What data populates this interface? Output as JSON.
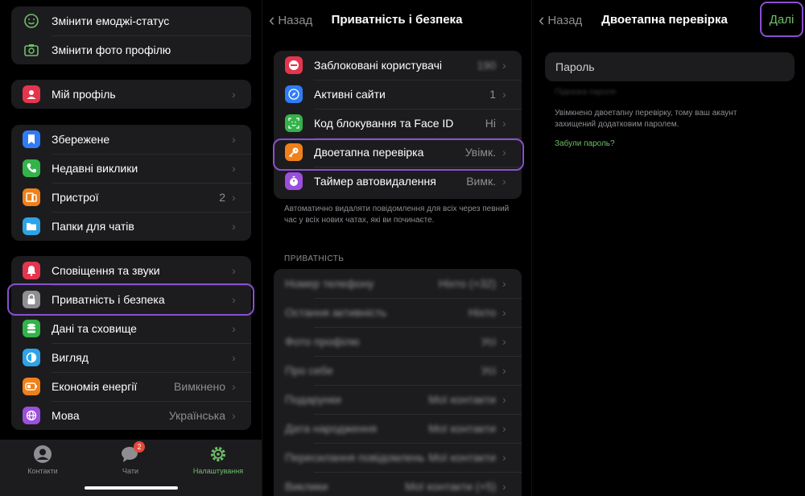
{
  "panel1": {
    "top_group": {
      "emoji_status": "Змінити емоджі-статус",
      "profile_photo": "Змінити фото профілю"
    },
    "profile": {
      "label": "Мій профіль"
    },
    "group2": [
      {
        "label": "Збережене",
        "value": ""
      },
      {
        "label": "Недавні виклики",
        "value": ""
      },
      {
        "label": "Пристрої",
        "value": "2"
      },
      {
        "label": "Папки для чатів",
        "value": ""
      }
    ],
    "group3": [
      {
        "label": "Сповіщення та звуки",
        "value": ""
      },
      {
        "label": "Приватність і безпека",
        "value": ""
      },
      {
        "label": "Дані та сховище",
        "value": ""
      },
      {
        "label": "Вигляд",
        "value": ""
      },
      {
        "label": "Економія енергії",
        "value": "Вимкнено"
      },
      {
        "label": "Мова",
        "value": "Українська"
      }
    ],
    "tabs": {
      "contacts": "Контакти",
      "chats": "Чати",
      "chats_badge": "2",
      "settings": "Налаштування"
    }
  },
  "panel2": {
    "back": "Назад",
    "title": "Приватність і безпека",
    "security": [
      {
        "label": "Заблоковані користувачі",
        "value": "190"
      },
      {
        "label": "Активні сайти",
        "value": "1"
      },
      {
        "label": "Код блокування та Face ID",
        "value": "Ні"
      },
      {
        "label": "Двоетапна перевірка",
        "value": "Увімк."
      },
      {
        "label": "Таймер автовидалення",
        "value": "Вимк."
      }
    ],
    "caption": "Автоматично видаляти повідомлення для всіх через певний час у всіх нових чатах, які ви починаєте.",
    "privacy_header": "ПРИВАТНІСТЬ",
    "privacy": [
      {
        "label": "Номер телефону",
        "value": "Ніхто (+32)"
      },
      {
        "label": "Остання активність",
        "value": "Ніхто"
      },
      {
        "label": "Фото профілю",
        "value": "Усі"
      },
      {
        "label": "Про себе",
        "value": "Усі"
      },
      {
        "label": "Подарунки",
        "value": "Мої контакти"
      },
      {
        "label": "Дата народження",
        "value": "Мої контакти"
      },
      {
        "label": "Пересилання повідомлень",
        "value": "Мої контакти"
      },
      {
        "label": "Виклики",
        "value": "Мої контакти (+5)"
      }
    ]
  },
  "panel3": {
    "back": "Назад",
    "title": "Двоетапна перевірка",
    "next": "Далі",
    "password_placeholder": "Пароль",
    "hint": "Підказка пароля",
    "description": "Увімкнено двоетапну перевірку, тому ваш акаунт захищений додатковим паролем.",
    "forgot": "Забули пароль?"
  },
  "colors": {
    "highlight": "#8a4fd1",
    "accent_green": "#6fbf6a",
    "cell_bg": "#1c1c1e"
  }
}
